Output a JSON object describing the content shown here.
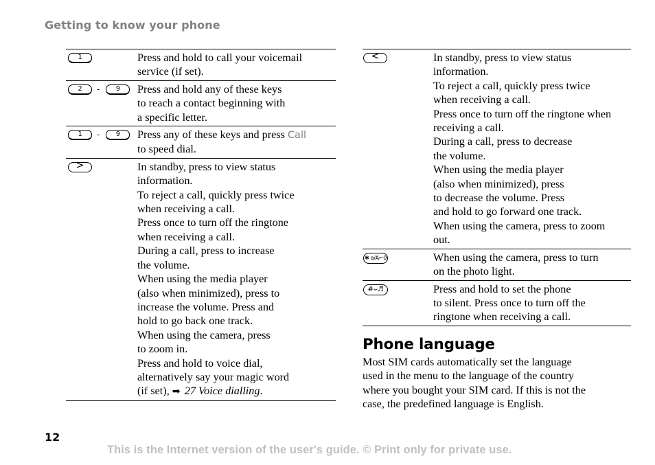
{
  "header": {
    "title": "Getting to know your phone"
  },
  "left_table": {
    "rows": [
      {
        "keys": {
          "first": "1"
        },
        "lines": [
          "Press and hold to call your voicemail",
          "service (if set)."
        ]
      },
      {
        "keys": {
          "first": "2",
          "separator": "-",
          "last": "9"
        },
        "lines": [
          "Press and hold any of these keys",
          "to reach a contact beginning with",
          "a specific letter."
        ]
      },
      {
        "keys": {
          "first": "1",
          "separator": "-",
          "last": "9"
        },
        "line_before_call": "Press any of these keys and press ",
        "call_label": "Call",
        "lines": [
          "to speed dial."
        ]
      },
      {
        "keys": {
          "first": ">"
        },
        "lines": [
          "In standby, press to view status",
          "information.",
          "To reject a call, quickly press twice",
          "when receiving a call.",
          "Press once to turn off the ringtone",
          "when receiving a call.",
          "During a call, press to increase",
          "the volume.",
          "When using the media player",
          "(also when minimized), press to",
          "increase the volume. Press and",
          "hold to go back one track.",
          "When using the camera, press",
          "to zoom in.",
          "Press and hold to voice dial,",
          "alternatively say your magic word"
        ],
        "ref_prefix": "(if set), ",
        "ref_arrow": "➡",
        "ref_text": "27 Voice dialling",
        "ref_suffix": "."
      }
    ]
  },
  "right_table": {
    "rows": [
      {
        "keys": {
          "first": "<"
        },
        "lines": [
          "In standby, press to view status",
          "information.",
          "To reject a call, quickly press twice",
          "when receiving a call.",
          "Press once to turn off the ringtone when",
          "receiving a call.",
          "During a call, press to decrease",
          "the volume.",
          "When using the media player",
          "(also when minimized), press",
          "to decrease the volume. Press",
          "and hold to go forward one track.",
          "When using the camera, press to zoom",
          "out."
        ]
      },
      {
        "keys": {
          "first": "✱ a/A⌐0"
        },
        "lines": [
          "When using the camera, press to turn",
          "on the photo light."
        ]
      },
      {
        "keys": {
          "first": "#⌣♬"
        },
        "lines": [
          "Press and hold to set the phone",
          "to silent. Press once to turn off the",
          "ringtone when receiving a call."
        ]
      }
    ]
  },
  "section": {
    "title": "Phone language",
    "lines": [
      "Most SIM cards automatically set the language",
      "used in the menu to the language of the country",
      "where you bought your SIM card. If this is not the",
      "case, the predefined language is English."
    ]
  },
  "footer": {
    "page_number": "12",
    "notice": "This is the Internet version of the user's guide. © Print only for private use."
  },
  "colors": {
    "header_gray": "#808080",
    "footer_gray": "#c0c0c0",
    "call_gray": "#808080"
  }
}
